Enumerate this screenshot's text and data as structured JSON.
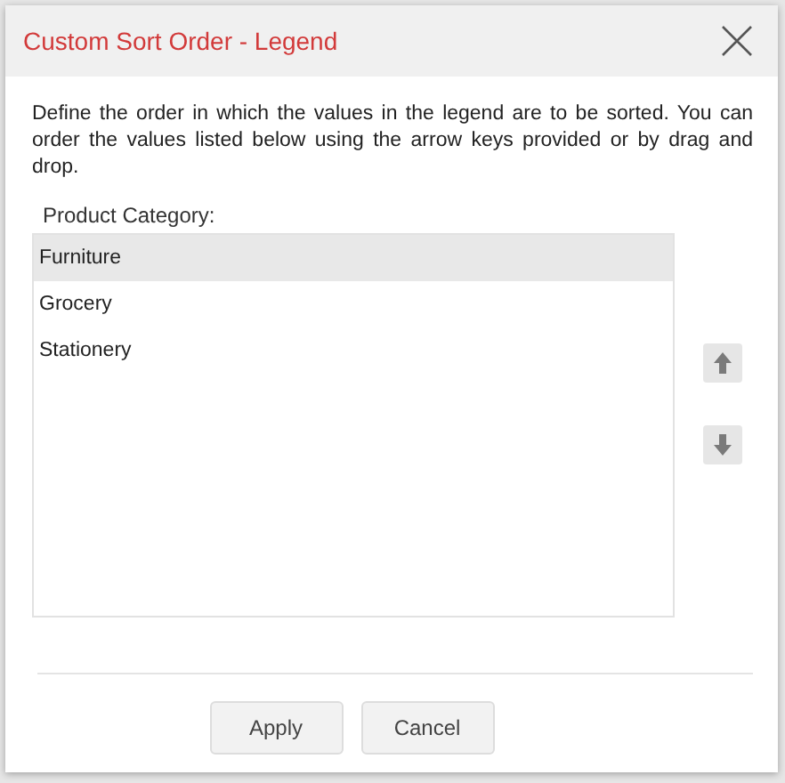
{
  "dialog": {
    "title": "Custom Sort Order - Legend",
    "description": "Define the order in which the values in the legend are to be sorted. You can order the values listed below using the arrow keys provided or by drag and drop."
  },
  "list": {
    "label": "Product Category:",
    "items": [
      {
        "label": "Furniture",
        "selected": true
      },
      {
        "label": "Grocery",
        "selected": false
      },
      {
        "label": "Stationery",
        "selected": false
      }
    ]
  },
  "buttons": [
    {
      "label": "Apply"
    },
    {
      "label": "Cancel"
    }
  ]
}
